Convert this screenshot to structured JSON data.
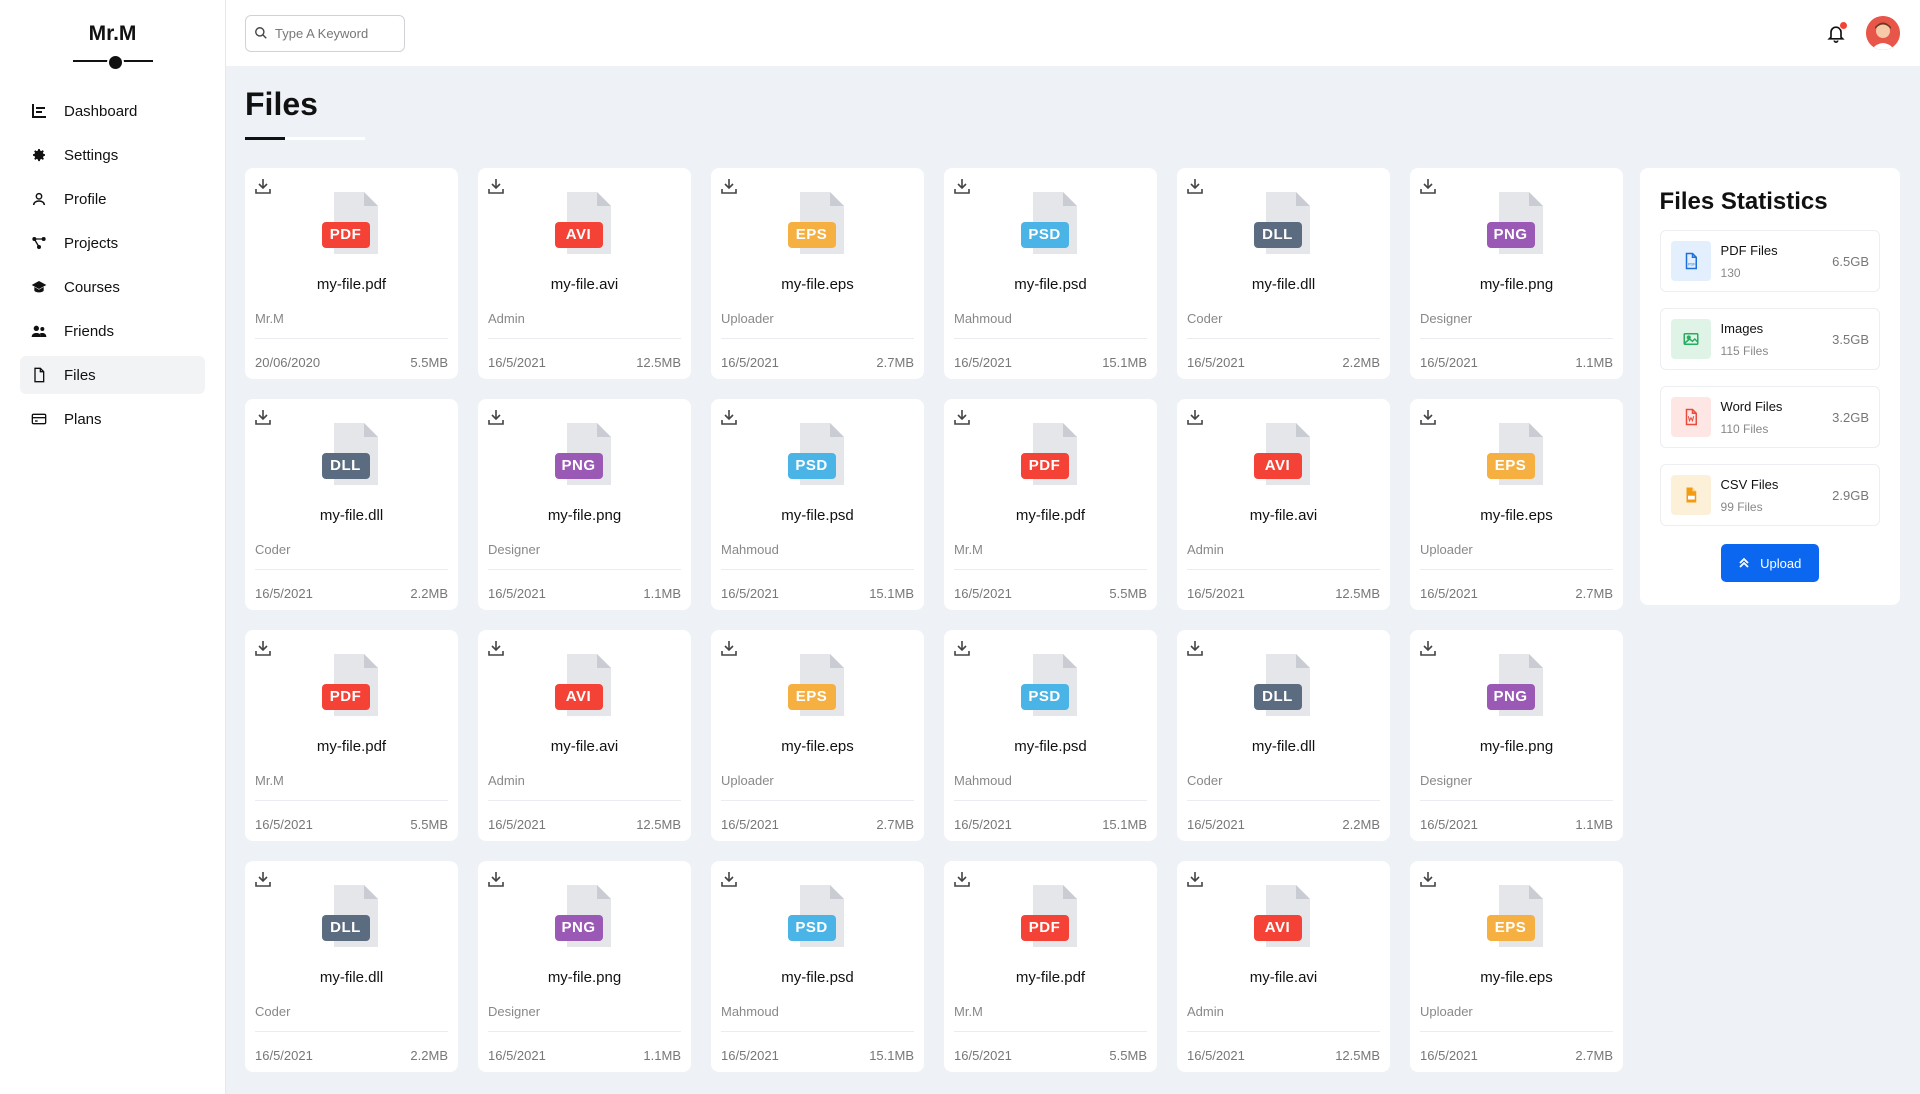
{
  "brand": "Mr.M",
  "sidebar": {
    "items": [
      {
        "label": "Dashboard",
        "icon": "chart-icon",
        "active": false
      },
      {
        "label": "Settings",
        "icon": "gear-icon",
        "active": false
      },
      {
        "label": "Profile",
        "icon": "user-icon",
        "active": false
      },
      {
        "label": "Projects",
        "icon": "projects-icon",
        "active": false
      },
      {
        "label": "Courses",
        "icon": "graduation-cap-icon",
        "active": false
      },
      {
        "label": "Friends",
        "icon": "users-icon",
        "active": false
      },
      {
        "label": "Files",
        "icon": "file-icon",
        "active": true
      },
      {
        "label": "Plans",
        "icon": "credit-card-icon",
        "active": false
      }
    ]
  },
  "search": {
    "placeholder": "Type A Keyword",
    "value": ""
  },
  "page_title": "Files",
  "colors": {
    "PDF": "#f44336",
    "AVI": "#f44336",
    "EPS": "#f5b041",
    "PSD": "#4ab4e6",
    "DLL": "#5b6c80",
    "PNG": "#9b59b6",
    "accent": "#0b66f0"
  },
  "files": [
    {
      "type": "PDF",
      "name": "my-file.pdf",
      "owner": "Mr.M",
      "date": "20/06/2020",
      "size": "5.5MB"
    },
    {
      "type": "AVI",
      "name": "my-file.avi",
      "owner": "Admin",
      "date": "16/5/2021",
      "size": "12.5MB"
    },
    {
      "type": "EPS",
      "name": "my-file.eps",
      "owner": "Uploader",
      "date": "16/5/2021",
      "size": "2.7MB"
    },
    {
      "type": "PSD",
      "name": "my-file.psd",
      "owner": "Mahmoud",
      "date": "16/5/2021",
      "size": "15.1MB"
    },
    {
      "type": "DLL",
      "name": "my-file.dll",
      "owner": "Coder",
      "date": "16/5/2021",
      "size": "2.2MB"
    },
    {
      "type": "PNG",
      "name": "my-file.png",
      "owner": "Designer",
      "date": "16/5/2021",
      "size": "1.1MB"
    },
    {
      "type": "DLL",
      "name": "my-file.dll",
      "owner": "Coder",
      "date": "16/5/2021",
      "size": "2.2MB"
    },
    {
      "type": "PNG",
      "name": "my-file.png",
      "owner": "Designer",
      "date": "16/5/2021",
      "size": "1.1MB"
    },
    {
      "type": "PSD",
      "name": "my-file.psd",
      "owner": "Mahmoud",
      "date": "16/5/2021",
      "size": "15.1MB"
    },
    {
      "type": "PDF",
      "name": "my-file.pdf",
      "owner": "Mr.M",
      "date": "16/5/2021",
      "size": "5.5MB"
    },
    {
      "type": "AVI",
      "name": "my-file.avi",
      "owner": "Admin",
      "date": "16/5/2021",
      "size": "12.5MB"
    },
    {
      "type": "EPS",
      "name": "my-file.eps",
      "owner": "Uploader",
      "date": "16/5/2021",
      "size": "2.7MB"
    },
    {
      "type": "PDF",
      "name": "my-file.pdf",
      "owner": "Mr.M",
      "date": "16/5/2021",
      "size": "5.5MB"
    },
    {
      "type": "AVI",
      "name": "my-file.avi",
      "owner": "Admin",
      "date": "16/5/2021",
      "size": "12.5MB"
    },
    {
      "type": "EPS",
      "name": "my-file.eps",
      "owner": "Uploader",
      "date": "16/5/2021",
      "size": "2.7MB"
    },
    {
      "type": "PSD",
      "name": "my-file.psd",
      "owner": "Mahmoud",
      "date": "16/5/2021",
      "size": "15.1MB"
    },
    {
      "type": "DLL",
      "name": "my-file.dll",
      "owner": "Coder",
      "date": "16/5/2021",
      "size": "2.2MB"
    },
    {
      "type": "PNG",
      "name": "my-file.png",
      "owner": "Designer",
      "date": "16/5/2021",
      "size": "1.1MB"
    },
    {
      "type": "DLL",
      "name": "my-file.dll",
      "owner": "Coder",
      "date": "16/5/2021",
      "size": "2.2MB"
    },
    {
      "type": "PNG",
      "name": "my-file.png",
      "owner": "Designer",
      "date": "16/5/2021",
      "size": "1.1MB"
    },
    {
      "type": "PSD",
      "name": "my-file.psd",
      "owner": "Mahmoud",
      "date": "16/5/2021",
      "size": "15.1MB"
    },
    {
      "type": "PDF",
      "name": "my-file.pdf",
      "owner": "Mr.M",
      "date": "16/5/2021",
      "size": "5.5MB"
    },
    {
      "type": "AVI",
      "name": "my-file.avi",
      "owner": "Admin",
      "date": "16/5/2021",
      "size": "12.5MB"
    },
    {
      "type": "EPS",
      "name": "my-file.eps",
      "owner": "Uploader",
      "date": "16/5/2021",
      "size": "2.7MB"
    }
  ],
  "stats": {
    "title": "Files Statistics",
    "items": [
      {
        "label": "PDF Files",
        "count": "130",
        "size": "6.5GB",
        "icon": "pdf-file-icon",
        "bg": "#e3effc",
        "fg": "#1e6fd9"
      },
      {
        "label": "Images",
        "count": "115 Files",
        "size": "3.5GB",
        "icon": "image-icon",
        "bg": "#dff3e6",
        "fg": "#27ae60"
      },
      {
        "label": "Word Files",
        "count": "110 Files",
        "size": "3.2GB",
        "icon": "word-file-icon",
        "bg": "#fde6e4",
        "fg": "#e74c3c"
      },
      {
        "label": "CSV Files",
        "count": "99 Files",
        "size": "2.9GB",
        "icon": "csv-file-icon",
        "bg": "#fdf0d8",
        "fg": "#f39c12"
      }
    ],
    "upload_label": "Upload"
  }
}
